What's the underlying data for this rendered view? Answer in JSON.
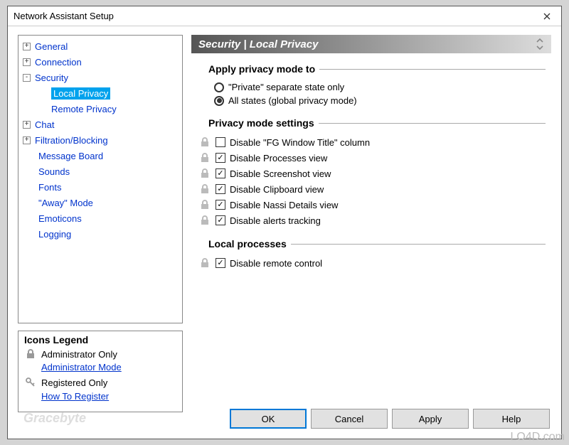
{
  "window": {
    "title": "Network Assistant Setup"
  },
  "tree": {
    "items": [
      {
        "label": "General",
        "expandable": true,
        "sign": "+"
      },
      {
        "label": "Connection",
        "expandable": true,
        "sign": "+"
      },
      {
        "label": "Security",
        "expandable": true,
        "sign": "-"
      },
      {
        "label": "Local Privacy",
        "child": true,
        "selected": true
      },
      {
        "label": "Remote Privacy",
        "child": true
      },
      {
        "label": "Chat",
        "expandable": true,
        "sign": "+"
      },
      {
        "label": "Filtration/Blocking",
        "expandable": true,
        "sign": "+"
      },
      {
        "label": "Message Board"
      },
      {
        "label": "Sounds"
      },
      {
        "label": "Fonts"
      },
      {
        "label": "\"Away\" Mode"
      },
      {
        "label": "Emoticons"
      },
      {
        "label": "Logging"
      }
    ]
  },
  "legend": {
    "title": "Icons Legend",
    "admin_label": "Administrator Only",
    "admin_link": "Administrator Mode",
    "reg_label": "Registered Only",
    "reg_link": "How To Register"
  },
  "header": {
    "breadcrumb": "Security | Local Privacy"
  },
  "group_apply": {
    "title": "Apply privacy mode to",
    "opt1": "\"Private\" separate state only",
    "opt2": "All states (global privacy mode)",
    "selected": "opt2"
  },
  "group_settings": {
    "title": "Privacy mode settings",
    "items": [
      {
        "label": "Disable \"FG Window Title\" column",
        "checked": false
      },
      {
        "label": "Disable Processes view",
        "checked": true
      },
      {
        "label": "Disable Screenshot view",
        "checked": true
      },
      {
        "label": "Disable Clipboard view",
        "checked": true
      },
      {
        "label": "Disable Nassi Details view",
        "checked": true
      },
      {
        "label": "Disable alerts tracking",
        "checked": true
      }
    ]
  },
  "group_local": {
    "title": "Local processes",
    "items": [
      {
        "label": "Disable remote control",
        "checked": true
      }
    ]
  },
  "buttons": {
    "ok": "OK",
    "cancel": "Cancel",
    "apply": "Apply",
    "help": "Help"
  },
  "watermarks": {
    "left": "Gracebyte",
    "right": "LO4D.com"
  }
}
